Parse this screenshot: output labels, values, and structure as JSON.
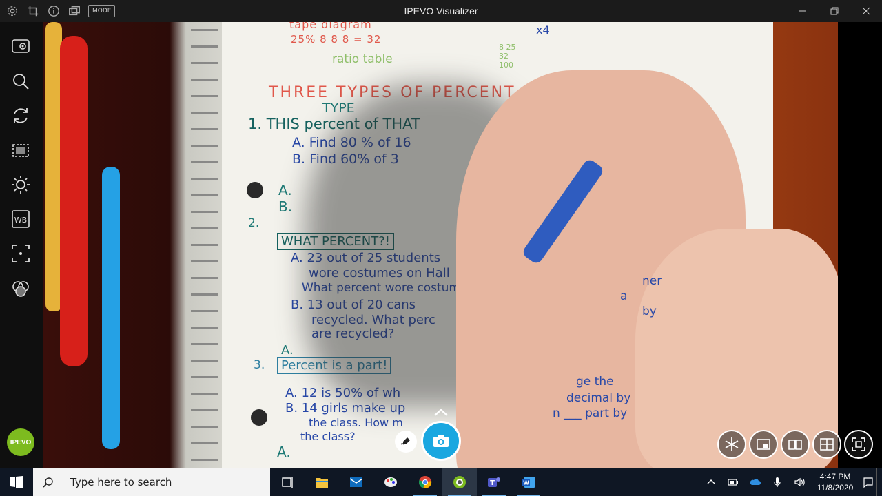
{
  "window": {
    "title": "IPEVO Visualizer",
    "mode_label": "MODE"
  },
  "sidebar": {
    "tools": [
      {
        "name": "camera-source-icon"
      },
      {
        "name": "zoom-icon"
      },
      {
        "name": "rotate-icon"
      },
      {
        "name": "crop-icon"
      },
      {
        "name": "brightness-icon"
      },
      {
        "name": "whiteboard-icon",
        "label": "WB"
      },
      {
        "name": "focus-icon"
      },
      {
        "name": "color-filter-icon"
      }
    ],
    "logo_label": "IPEVO"
  },
  "camera_view": {
    "notes": {
      "tape_diagram": "tape diagram",
      "tape_values": "25%  8  8  8  = 32",
      "ratio_table": "ratio table",
      "heading": "THREE TYPES OF PERCENT PROBLEMS",
      "type_label": "TYPE",
      "item1": "1. THIS percent of THAT",
      "item1a": "A. Find 80 % of 16",
      "item1b": "B. Find 60% of 3",
      "ans_a": "A.",
      "ans_b": "B.",
      "item2_num": "2.",
      "item2": "WHAT PERCENT?!",
      "item2a_1": "A. 23 out of 25 students",
      "item2a_2": "wore costumes on Hall",
      "item2a_3": "What percent wore costum",
      "item2b_1": "B. 13 out of 20 cans",
      "item2b_2": "recycled. What perc",
      "item2b_3": "are recycled?",
      "ans2": "A.",
      "item3_num": "3.",
      "item3": "Percent is a part!",
      "item3a": "A. 12 is 50% of wh",
      "item3b_1": "B. 14 girls make up",
      "item3b_2": "the class. How m",
      "item3b_3": "the class?",
      "ans3": "A.",
      "side1": "ge the",
      "side2": "decimal by",
      "side3": "n ___ part by",
      "side4": "by",
      "side5": "ner",
      "side6": "a",
      "times4": "x4",
      "ratio_cells": "8 25 32 100"
    }
  },
  "overlays": {
    "right_tools": [
      {
        "name": "freeze-icon"
      },
      {
        "name": "picture-in-picture-icon"
      },
      {
        "name": "book-mode-icon"
      },
      {
        "name": "grid-view-icon"
      },
      {
        "name": "fullscreen-icon"
      }
    ]
  },
  "taskbar": {
    "search_placeholder": "Type here to search",
    "apps": [
      {
        "name": "task-view-icon",
        "running": false
      },
      {
        "name": "file-explorer-icon",
        "running": false
      },
      {
        "name": "mail-icon",
        "running": false
      },
      {
        "name": "paint-icon",
        "running": false
      },
      {
        "name": "chrome-icon",
        "running": true
      },
      {
        "name": "ipevo-visualizer-icon",
        "running": true,
        "active": true
      },
      {
        "name": "teams-icon",
        "running": true
      },
      {
        "name": "word-icon",
        "running": true
      }
    ],
    "clock_time": "4:47 PM",
    "clock_date": "11/8/2020"
  },
  "colors": {
    "accent_blue": "#1aa7e0",
    "ipevo_green": "#7dbb1f",
    "taskbar_bg": "#0f1724"
  }
}
